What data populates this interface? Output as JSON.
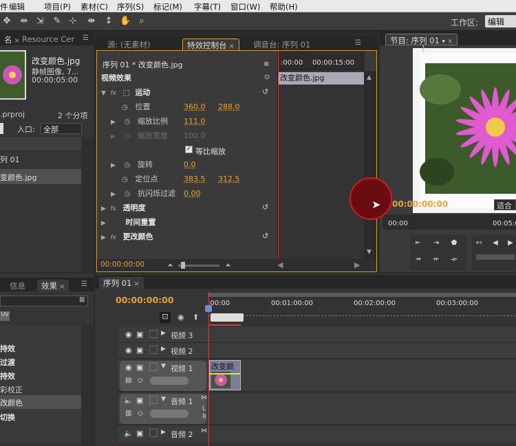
{
  "menu": [
    "件",
    "编辑",
    "项目(P)",
    "素材(C)",
    "序列(S)",
    "标记(M)",
    "字幕(T)",
    "窗口(W)",
    "帮助(H)"
  ],
  "toolbar": {
    "icons": [
      "selection-tool-icon",
      "track-select-icon",
      "ripple-edit-icon",
      "rolling-edit-icon",
      "rate-stretch-icon",
      "razor-icon",
      "slip-icon",
      "slide-icon",
      "pen-icon",
      "hand-icon",
      "zoom-icon"
    ],
    "workspace_label": "工作区:",
    "workspace_value": "编辑"
  },
  "project": {
    "tab_partial": "名",
    "tab_resource": "Resource Cer",
    "clip_name": "改变颜色.jpg",
    "clip_type": "静帧图像, 7...",
    "clip_duration": "00:00:05:00",
    "project_file": ".prproj",
    "items_count": "2 个分项",
    "entry_label": "入口:",
    "entry_value": "全部",
    "list": [
      "列 01",
      "变颜色.jpg"
    ]
  },
  "source_tabs": {
    "source": "源: (无素材)",
    "effect_controls": "特效控制台",
    "mixer": "调音台: 序列 01"
  },
  "effect_controls": {
    "sequence_clip": "序列 01 * 改变颜色.jpg",
    "video_effects_label": "视频效果",
    "motion_label": "运动",
    "position_label": "位置",
    "position_x": "360.0",
    "position_y": "288.0",
    "scale_label": "缩放比例",
    "scale_value": "111.0",
    "scale_width_label": "缩放宽度",
    "scale_width_value": "100.0",
    "uniform_scale_label": "等比缩放",
    "rotation_label": "旋转",
    "rotation_value": "0.0",
    "anchor_label": "定位点",
    "anchor_x": "383.5",
    "anchor_y": "312.5",
    "flicker_label": "抗闪烁过滤",
    "flicker_value": "0.00",
    "opacity_label": "透明度",
    "time_remap_label": "时间重置",
    "change_color_label": "更改颜色",
    "time_start": ":00:00",
    "time_end": "00:00:15:00",
    "clip_bar_label": "改变颜色.jpg",
    "current_time": "00:00:00:00"
  },
  "program": {
    "tab": "节目: 序列 01",
    "timecode": "00:00:00:00",
    "fit_label": "适合",
    "ruler_start": "00:00",
    "ruler_end": "00:05:0"
  },
  "effects_panel": {
    "tab_info": "信息",
    "tab_effects": "效果",
    "items": [
      "持效",
      "过渡",
      "持效",
      "彩校正",
      "改颜色",
      "切换"
    ]
  },
  "timeline": {
    "tab": "序列 01",
    "timecode": "00:00:00:00",
    "ruler": [
      ":00:00",
      "00:01:00:00",
      "00:02:00:00",
      "00:03:00:00"
    ],
    "tracks": {
      "video3": "视频 3",
      "video2": "视频 2",
      "video1": "视频 1",
      "audio1": "音频 1",
      "audio2": "音频 2"
    },
    "clip_label": "改变颜色",
    "lr_labels": [
      "L",
      "R"
    ]
  },
  "colors": {
    "accent_orange": "#e8a23a",
    "playhead_red": "#d63a3a",
    "panel_bg": "#3a3a3a",
    "cursor_ring": "#c0161d"
  }
}
